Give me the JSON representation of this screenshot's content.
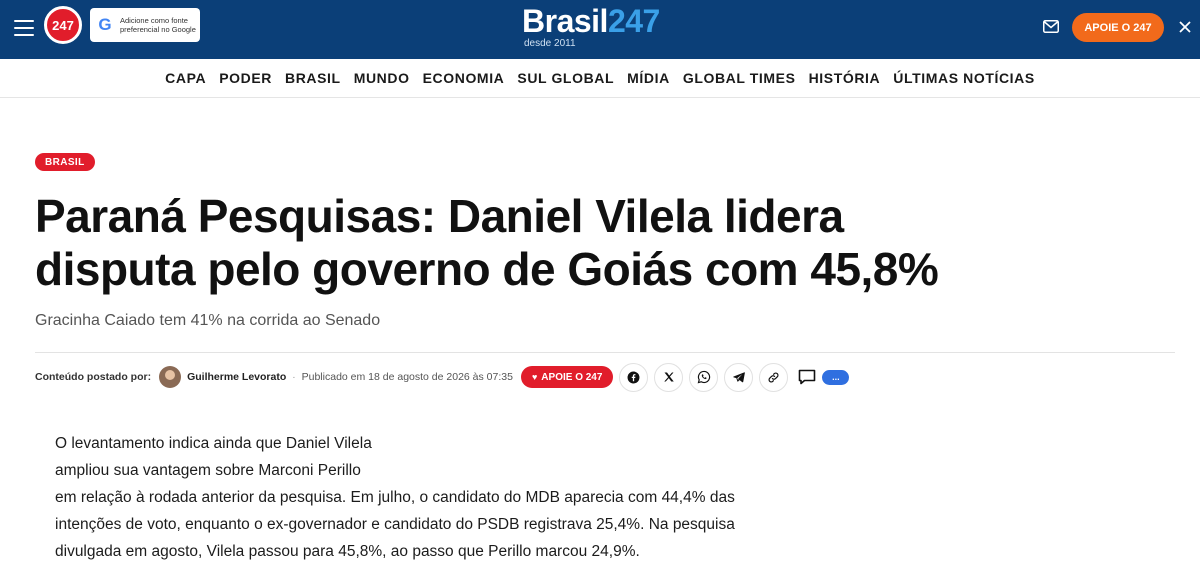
{
  "header": {
    "logo_badge": "247",
    "google_badge_text": "Adicione como fonte preferencial no Google",
    "brand_main": "Brasil",
    "brand_accent": "247",
    "brand_sub": "desde 2011",
    "apoie_label": "APOIE O 247",
    "colors": {
      "bar": "#0b3f78",
      "accent": "#3aa0e8",
      "apoie": "#f26a1b",
      "red": "#e11d2b"
    }
  },
  "nav": {
    "items": [
      "CAPA",
      "PODER",
      "BRASIL",
      "MUNDO",
      "ECONOMIA",
      "SUL GLOBAL",
      "MÍDIA",
      "GLOBAL TIMES",
      "HISTÓRIA",
      "ÚLTIMAS NOTÍCIAS"
    ]
  },
  "article": {
    "tag": "BRASIL",
    "title_line1": "Paraná Pesquisas: Daniel Vilela lidera",
    "title_line2": "disputa pelo governo de Goiás com 45,8%",
    "subtitle": "Gracinha Caiado tem 41% na corrida ao Senado",
    "meta": {
      "posted_by_label": "Conteúdo postado por:",
      "author": "Guilherme Levorato",
      "separator": "·",
      "published": "Publicado em 18 de agosto de 2026 às 07:35",
      "apoie_label": "APOIE O 247",
      "share_icons": [
        "facebook-icon",
        "x-icon",
        "whatsapp-icon",
        "telegram-icon",
        "link-icon"
      ],
      "more_label": "..."
    },
    "body_lines": [
      "O levantamento indica ainda que Daniel Vilela",
      "ampliou sua vantagem sobre Marconi Perillo",
      "em relação à rodada anterior da pesquisa. Em julho, o candidato do MDB aparecia com 44,4% das",
      "intenções de voto, enquanto o ex-governador e candidato do PSDB registrava 25,4%. Na pesquisa",
      "divulgada em agosto, Vilela passou para 45,8%, ao passo que Perillo marcou 24,9%."
    ]
  }
}
